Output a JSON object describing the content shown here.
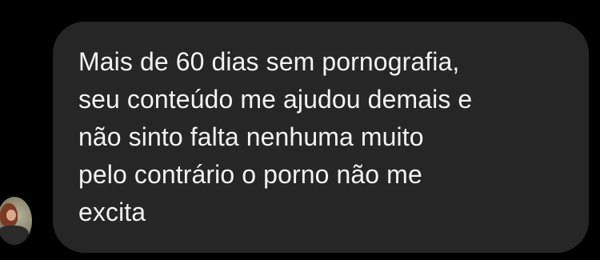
{
  "message": {
    "text": "Mais de 60 dias sem pornografia,\nseu conteúdo me ajudou demais e\nnão sinto falta nenhuma muito\npelo contrário o porno não me\nexcita",
    "bubble_color": "#262626",
    "text_color": "#f2f2f2"
  },
  "sender": {
    "avatar_icon": "profile-photo"
  },
  "colors": {
    "background": "#000000"
  }
}
